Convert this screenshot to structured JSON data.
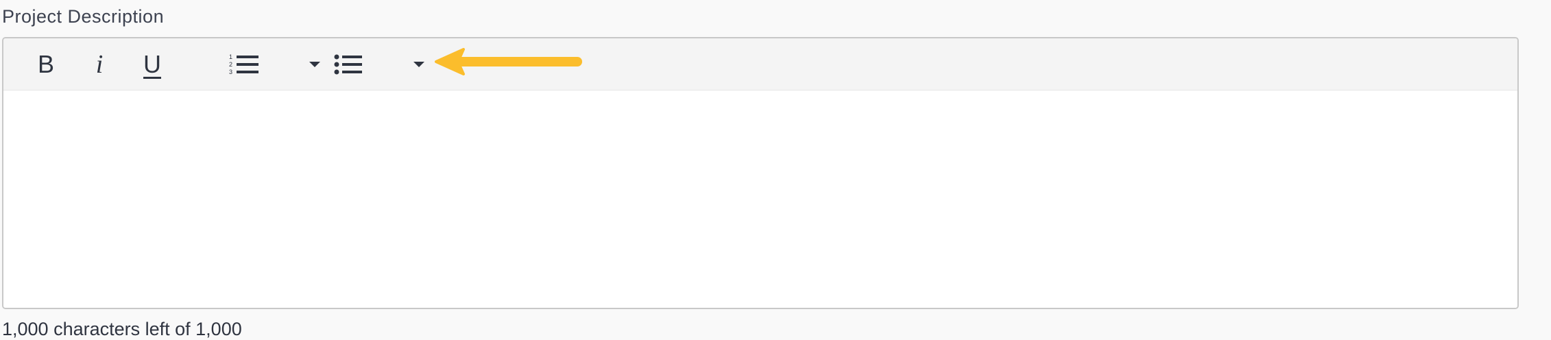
{
  "field": {
    "label": "Project Description"
  },
  "toolbar": {
    "bold_label": "B",
    "italic_label": "i",
    "underline_label": "U",
    "buttons": [
      {
        "icon": "bold-icon"
      },
      {
        "icon": "italic-icon"
      },
      {
        "icon": "underline-icon"
      },
      {
        "icon": "ordered-list-icon"
      },
      {
        "icon": "caret-down-icon"
      },
      {
        "icon": "unordered-list-icon"
      },
      {
        "icon": "caret-down-icon"
      }
    ]
  },
  "annotation": {
    "icon": "arrow-left-icon",
    "color": "#fbbd2c"
  },
  "editor": {
    "content": ""
  },
  "footer": {
    "char_count": "1,000 characters left of 1,000"
  }
}
